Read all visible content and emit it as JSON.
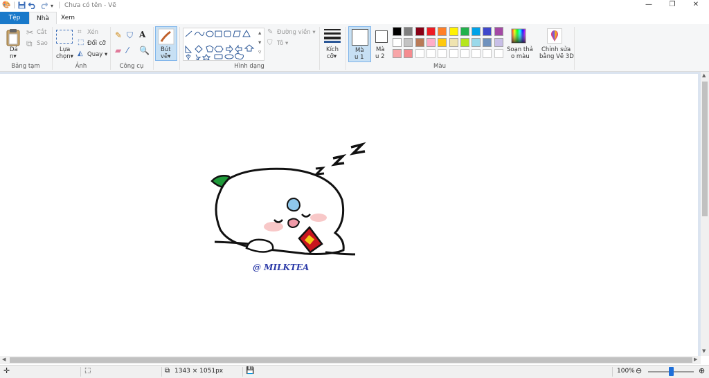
{
  "window": {
    "title": "Chưa có tên - Vẽ",
    "qa_save_icon": "save-icon",
    "qa_undo_icon": "undo-icon",
    "qa_redo_icon": "redo-icon"
  },
  "tabs": [
    {
      "label": "Tệp"
    },
    {
      "label": "Nhà"
    },
    {
      "label": "Xem"
    }
  ],
  "ribbon": {
    "clipboard": {
      "paste": "Dá",
      "paste2": "n",
      "cut": "Cắt",
      "copy": "Sao",
      "label": "Bảng tạm"
    },
    "image": {
      "select": "Lựa",
      "select2": "chọn",
      "crop": "Xén",
      "resize": "Đổi cỡ",
      "rotate": "Quay",
      "label": "Ảnh"
    },
    "tools": {
      "label": "Công cụ"
    },
    "brushes": {
      "label": "Bút",
      "label2": "vẽ"
    },
    "shapes": {
      "outline": "Đường viền",
      "fill": "Tô",
      "label": "Hình dạng"
    },
    "size": {
      "label": "Kích",
      "label2": "cỡ"
    },
    "colors": {
      "color1": "Mà",
      "color1b": "u 1",
      "color2": "Mà",
      "color2b": "u 2",
      "edit": "Soạn thả",
      "edit2": "o màu",
      "paint3d": "Chỉnh sửa",
      "paint3d2": "bằng Vẽ 3D",
      "label": "Màu",
      "palette_row1": [
        "#000000",
        "#7f7f7f",
        "#880015",
        "#ed1c24",
        "#ff7f27",
        "#fff200",
        "#22b14c",
        "#00a2e8",
        "#3f48cc",
        "#a349a4"
      ],
      "palette_row2": [
        "#ffffff",
        "#c3c3c3",
        "#b97a57",
        "#ffaec9",
        "#ffc90e",
        "#efe4b0",
        "#b5e61d",
        "#99d9ea",
        "#7092be",
        "#c8bfe7"
      ],
      "palette_row3": [
        "#f8a5a8",
        "#f58b8f",
        "",
        "",
        "",
        "",
        "",
        "",
        "",
        ""
      ]
    }
  },
  "canvas": {
    "watermark": "@ MILKTEA"
  },
  "status": {
    "image_size": "1343 × 1051px",
    "zoom": "100%",
    "zoom_level": 0.5
  }
}
